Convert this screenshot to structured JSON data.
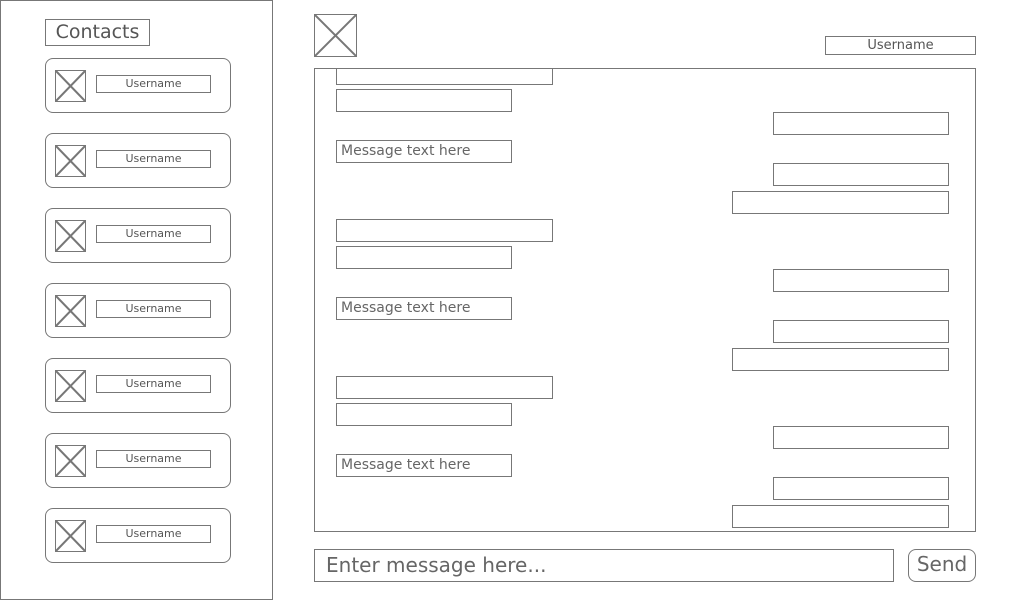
{
  "sidebar": {
    "title": "Contacts",
    "contacts": [
      {
        "name": "Username"
      },
      {
        "name": "Username"
      },
      {
        "name": "Username"
      },
      {
        "name": "Username"
      },
      {
        "name": "Username"
      },
      {
        "name": "Username"
      },
      {
        "name": "Username"
      }
    ]
  },
  "header": {
    "avatar_icon": "image-placeholder-icon",
    "username": "Username"
  },
  "chat": {
    "messages": [
      {
        "side": "left",
        "text": ""
      },
      {
        "side": "left",
        "text": ""
      },
      {
        "side": "right",
        "text": ""
      },
      {
        "side": "left",
        "text": "Message text here"
      },
      {
        "side": "right",
        "text": ""
      },
      {
        "side": "right",
        "text": ""
      },
      {
        "side": "left",
        "text": ""
      },
      {
        "side": "left",
        "text": ""
      },
      {
        "side": "right",
        "text": ""
      },
      {
        "side": "left",
        "text": "Message text here"
      },
      {
        "side": "right",
        "text": ""
      },
      {
        "side": "right",
        "text": ""
      },
      {
        "side": "left",
        "text": ""
      },
      {
        "side": "left",
        "text": ""
      },
      {
        "side": "right",
        "text": ""
      },
      {
        "side": "left",
        "text": "Message text here"
      },
      {
        "side": "right",
        "text": ""
      },
      {
        "side": "right",
        "text": ""
      }
    ]
  },
  "composer": {
    "placeholder": "Enter message here...",
    "send_label": "Send"
  }
}
